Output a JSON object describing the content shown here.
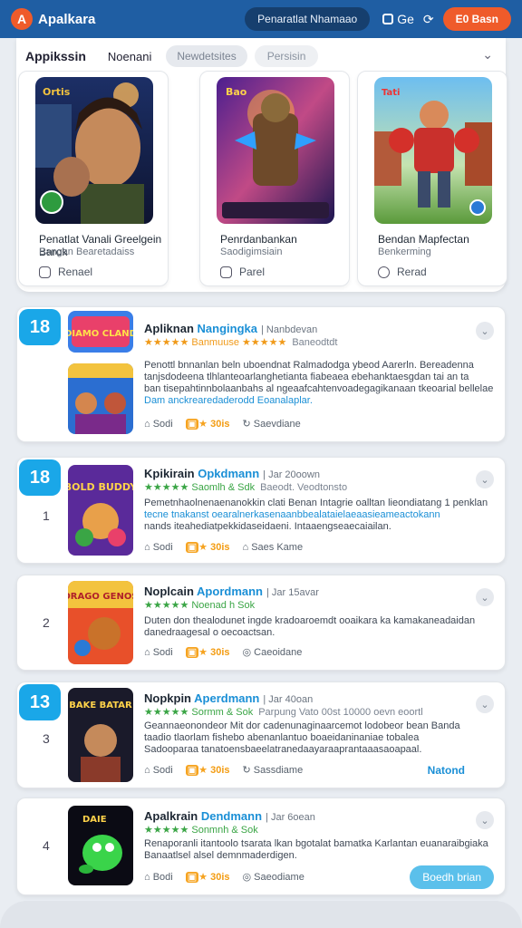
{
  "topbar": {
    "logo_letter": "A",
    "title": "Apalkara",
    "search_pill": "Penaratlat Nhamaao",
    "icon_text": "Ge",
    "action_button": "E0 Basn",
    "accent": "#1f5ea3",
    "cta_color": "#ef5b2a"
  },
  "featured": {
    "tabs": [
      "Appikssin",
      "Noenani",
      "Newdetsites",
      "Persisin"
    ],
    "cards": [
      {
        "name": "Penatlat Vanali Greelgein Barok",
        "sub": "Bangan Bearetadaiss",
        "action": "Renael",
        "art_label": "Ortis"
      },
      {
        "name": "Penrdanbankan",
        "sub": "Saodigimsiain",
        "action": "Parel",
        "art_label": "Bao"
      },
      {
        "name": "Bendan Mapfectan",
        "sub": "Benkerming",
        "action": "Rerad",
        "art_label": "Tati"
      }
    ]
  },
  "list": [
    {
      "badge": "18",
      "rank": "",
      "name": "Apliknan",
      "name_accent": "Nangingka",
      "meta": "| Nanbdevan",
      "stars_label": "★★★★★ Banmuuse ★★★★★",
      "stars_sub": "Baneodtdt",
      "desc": [
        "Penottl bnnanlan beln uboendnat Ralmadodga ybeod Aarerln. Bereadenna",
        "tanjsdodeena tlhlanteoarlanghetianta fiabeaea ebehanktaesgdan tai an ta",
        "ban tisepahtinnbolaanbahs al ngeaafcahtenvoadegagikanaan tkeoarial bellelae",
        "Dam anckrearedaderodd Eoanalaplar."
      ],
      "actions": {
        "a": "Sodi",
        "b": "30is",
        "c": "Saevdiane"
      },
      "icon_text": "DIAMO CLAND"
    },
    {
      "badge": "18",
      "rank": "1",
      "name": "Kpikirain",
      "name_accent": "Opkdmann",
      "meta": "| Jar 20oown",
      "stars_label": "★★★★★ Saomlh & Sdk",
      "stars_sub": "Baeodt. Veodtonsto",
      "desc": [
        "Pemetnhaolnenaenanokkin clati  Benan Intagrie oalltan lieondiatang 1 penklan",
        "tecne tnakanst oearalnerkasenaanbbealataielaeaasieameactokann",
        "nands iteahediatpekkidaseidaeni. Intaaengseaecaiailan."
      ],
      "actions": {
        "a": "Sodi",
        "b": "30is",
        "c": "Saes Kame"
      },
      "icon_text": "BOLD BUDDY"
    },
    {
      "badge": "",
      "rank": "2",
      "name": "Noplcain",
      "name_accent": "Apordmann",
      "meta": "| Jar 15avar",
      "stars_label": "★★★★★ Noenad h Sok",
      "stars_sub": "",
      "desc": [
        "Duten don thealodunet ingde kradoaroemdt ooaikara ka kamakaneadaidan",
        "danedraagesal o oecoactsan."
      ],
      "actions": {
        "a": "Sodi",
        "b": "30is",
        "c": "Caeoidane"
      },
      "icon_text": "DRAGO GENOS"
    },
    {
      "badge": "13",
      "rank": "3",
      "name": "Nopkpin",
      "name_accent": "Aperdmann",
      "meta": "| Jar 40oan",
      "stars_label": "★★★★★ Sormm & Sok",
      "stars_sub": "Parpung Vato 00st 10000 oevn eoortl",
      "desc": [
        "Geannaeonondeor Mit dor cadenunaginaarcemot lodobeor bean      Banda",
        "taadio tlaorlam fishebo abenanlantuo boaeidaninaniae tobalea",
        "Sadooparaa tanatoensbaeelatranedaayaraaprantaaasaoapaal."
      ],
      "actions": {
        "a": "Sodi",
        "b": "30is",
        "c": "Sassdiame"
      },
      "link": "Natond",
      "icon_text": "BAKE BATAR"
    },
    {
      "badge": "",
      "rank": "4",
      "name": "Apalkrain",
      "name_accent": "Dendmann",
      "meta": "| Jar 6oean",
      "stars_label": "★★★★★ Sonmnh & Sok",
      "stars_sub": "",
      "desc": [
        "Renaporanli itantoolo tsarata lkan bgotalat bamatka Karlantan euanaraibgiaka",
        "Banaatlsel alsel demnmaderdigen."
      ],
      "actions": {
        "a": "Bodi",
        "b": "30is",
        "c": "Saeodiame"
      },
      "cta": "Boedh brian",
      "icon_text": "DAIE"
    }
  ]
}
